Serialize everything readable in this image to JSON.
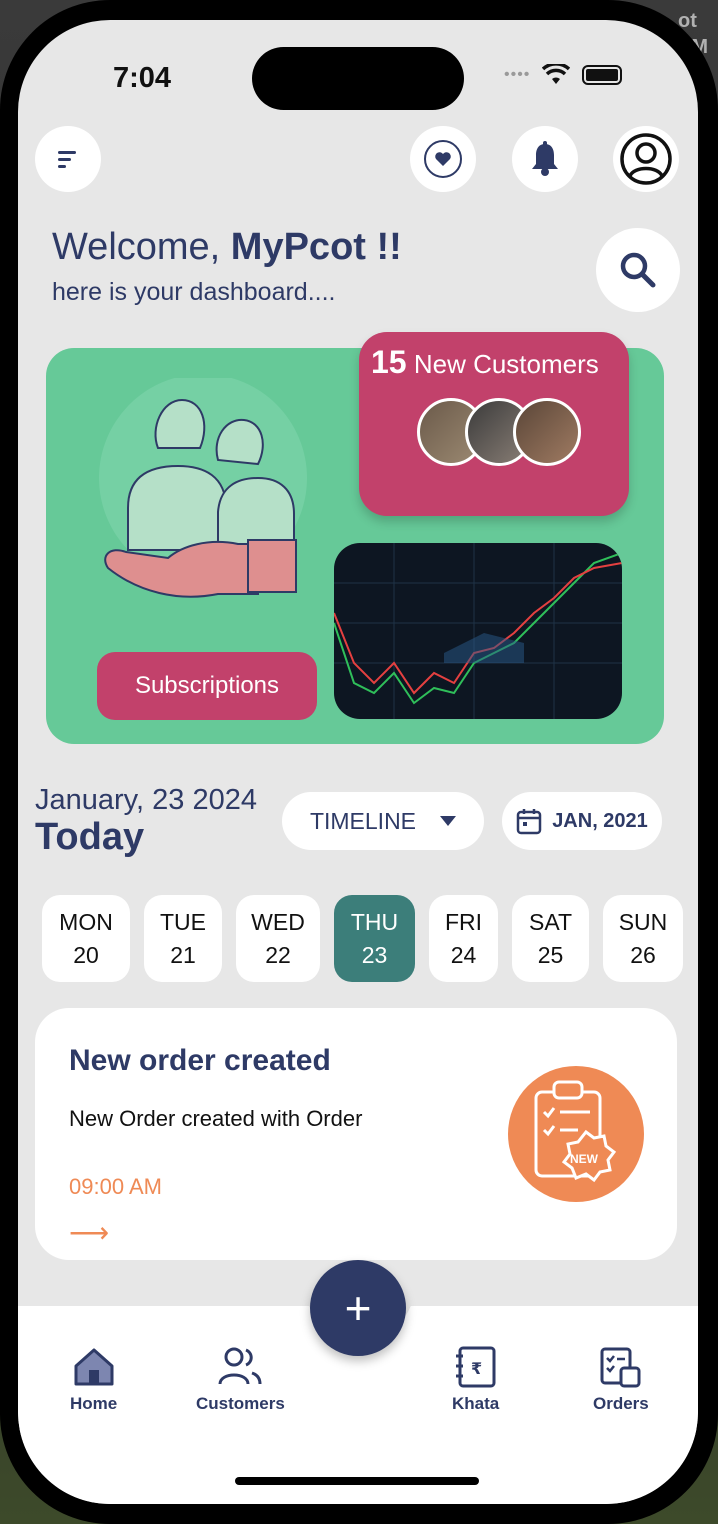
{
  "status_bar": {
    "time": "7:04"
  },
  "background_text": [
    "ot",
    "PM"
  ],
  "header": {
    "welcome_prefix": "Welcome, ",
    "welcome_name": "MyPcot !!",
    "subtitle": "here is your dashboard...."
  },
  "banner": {
    "new_customers_count": "15",
    "new_customers_label": "New Customers",
    "subscriptions_label": "Subscriptions"
  },
  "date_section": {
    "date": "January, 23 2024",
    "today": "Today",
    "timeline_label": "TIMELINE",
    "month_label": "JAN, 2021"
  },
  "days": [
    {
      "name": "MON",
      "num": "20"
    },
    {
      "name": "TUE",
      "num": "21"
    },
    {
      "name": "WED",
      "num": "22"
    },
    {
      "name": "THU",
      "num": "23"
    },
    {
      "name": "FRI",
      "num": "24"
    },
    {
      "name": "SAT",
      "num": "25"
    },
    {
      "name": "SUN",
      "num": "26"
    }
  ],
  "order": {
    "title": "New order created",
    "text": "New Order created with Order",
    "time": "09:00 AM",
    "arrow": "⟶",
    "badge": "NEW"
  },
  "fab_label": "+",
  "nav": {
    "home": "Home",
    "customers": "Customers",
    "khata": "Khata",
    "orders": "Orders"
  },
  "colors": {
    "primary": "#2e3a66",
    "accent": "#c2416b",
    "banner": "#66c998",
    "active_day": "#3c7e7a",
    "orange": "#ef8a55"
  }
}
